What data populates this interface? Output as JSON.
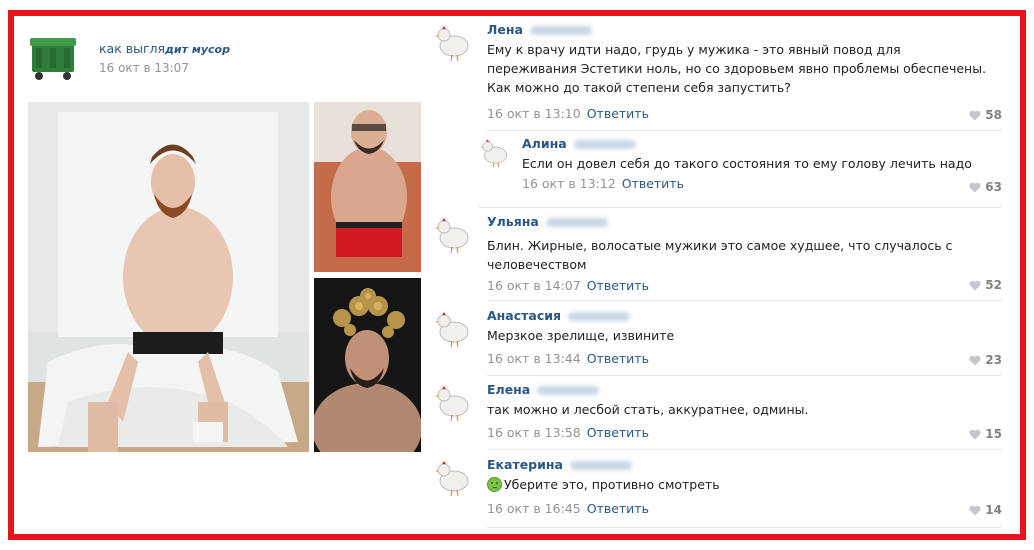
{
  "post": {
    "group_name_start": "как выгля",
    "group_name_tail": "дит мусор",
    "date": "16 окт в 13:07"
  },
  "comments": [
    {
      "name": "Лена",
      "text": "Ему к врачу идти надо, грудь у мужика - это явный повод для переживания Эстетики ноль, но со здоровьем явно проблемы обеспечены. Как можно до такой степени себя запустить?",
      "time": "16 окт в 13:10",
      "reply_label": "Ответить",
      "likes": "58"
    },
    {
      "name": "Алина",
      "text": "Если он довел себя до такого состояния то ему голову лечить надо",
      "time": "16 окт в 13:12",
      "reply_label": "Ответить",
      "likes": "63"
    },
    {
      "name": "Ульяна",
      "text": "Блин. Жирные, волосатые мужики это самое худшее, что случалось с человечеством",
      "time": "16 окт в 14:07",
      "reply_label": "Ответить",
      "likes": "52"
    },
    {
      "name": "Анастасия",
      "text": "Мерзкое зрелище, извините",
      "time": "16 окт в 13:44",
      "reply_label": "Ответить",
      "likes": "23"
    },
    {
      "name": "Елена",
      "text": "так можно и лесбой стать, аккуратнее, одмины.",
      "time": "16 окт в 13:58",
      "reply_label": "Ответить",
      "likes": "15"
    },
    {
      "name": "Екатерина",
      "text": "Уберите это, противно смотреть",
      "time": "16 окт в 16:45",
      "reply_label": "Ответить",
      "likes": "14"
    }
  ],
  "colors": {
    "frame": "#e8141b",
    "link": "#2a5885",
    "meta": "#939393"
  },
  "icons": [
    "trash-bin-avatar",
    "chicken-avatar",
    "heart-icon",
    "sick-face-emoji"
  ]
}
